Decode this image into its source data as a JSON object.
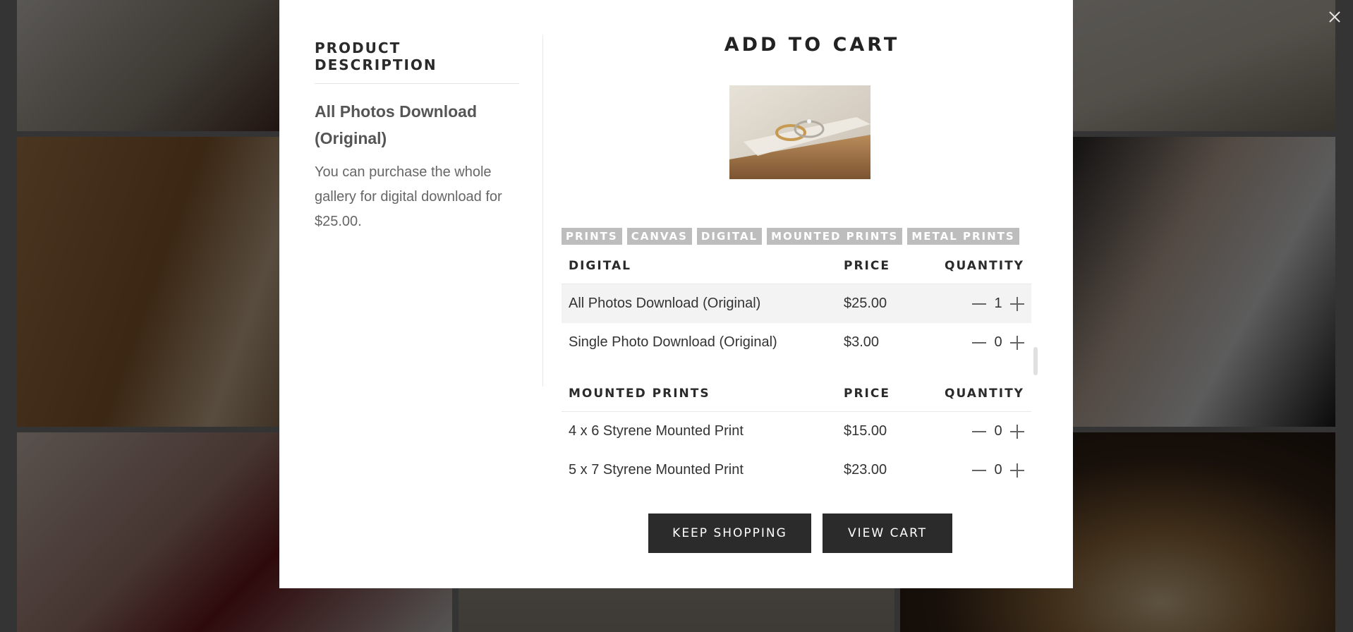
{
  "modal": {
    "close_icon": "close-icon",
    "description": {
      "heading": "PRODUCT DESCRIPTION",
      "product_name": "All Photos Download (Original)",
      "text": "You can purchase the whole gallery for digital download for $25.00."
    },
    "cart": {
      "title": "ADD TO CART",
      "tabs": [
        "PRINTS",
        "CANVAS",
        "DIGITAL",
        "MOUNTED PRINTS",
        "METAL PRINTS"
      ],
      "sections": [
        {
          "name": "DIGITAL",
          "price_header": "PRICE",
          "qty_header": "QUANTITY",
          "items": [
            {
              "name": "All Photos Download (Original)",
              "price": "$25.00",
              "qty": "1"
            },
            {
              "name": "Single Photo Download (Original)",
              "price": "$3.00",
              "qty": "0"
            }
          ]
        },
        {
          "name": "MOUNTED PRINTS",
          "price_header": "PRICE",
          "qty_header": "QUANTITY",
          "items": [
            {
              "name": "4 x 6 Styrene Mounted Print",
              "price": "$15.00",
              "qty": "0"
            },
            {
              "name": "5 x 7 Styrene Mounted Print",
              "price": "$23.00",
              "qty": "0"
            }
          ]
        }
      ]
    },
    "buttons": {
      "keep_shopping": "KEEP SHOPPING",
      "view_cart": "VIEW CART"
    }
  },
  "colors": {
    "button_bg": "#2b2b2b",
    "tab_bg": "#bdbdbd",
    "row_shade": "#f3f3f3"
  }
}
